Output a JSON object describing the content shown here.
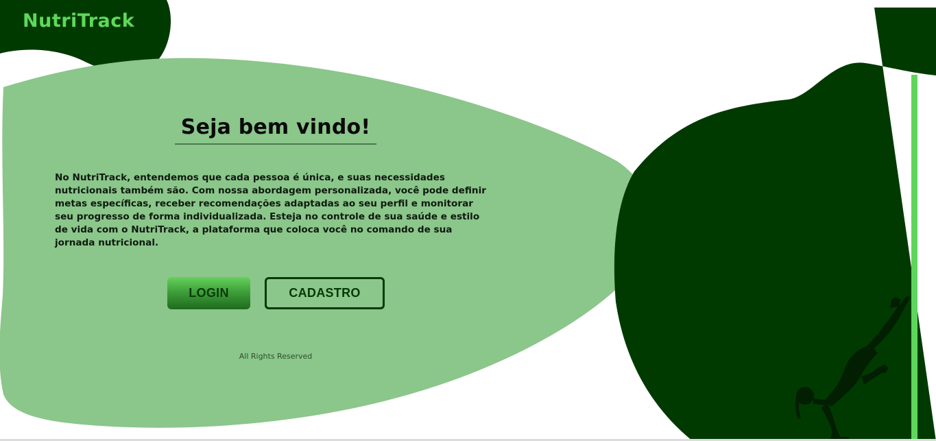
{
  "brand": {
    "logo_text": "NutriTrack"
  },
  "welcome": {
    "title": "Seja bem vindo!",
    "description": "No NutriTrack, entendemos que cada pessoa é única, e suas necessidades nutricionais também são. Com nossa abordagem personalizada, você pode definir metas específicas, receber recomendações adaptadas ao seu perfil e monitorar seu progresso de forma individualizada. Esteja no controle de sua saúde e estilo de vida com o NutriTrack, a plataforma que coloca você no comando de sua jornada nutricional."
  },
  "actions": {
    "login_label": "LOGIN",
    "signup_label": "CADASTRO"
  },
  "footer": {
    "rights_text": "All Rights Reserved"
  },
  "colors": {
    "dark_green": "#013a01",
    "light_green": "#8bc68b",
    "accent_green": "#5ed65b",
    "logo_green": "#5fd85a"
  },
  "icons": {
    "hero_figure": "athlete-silhouette"
  }
}
